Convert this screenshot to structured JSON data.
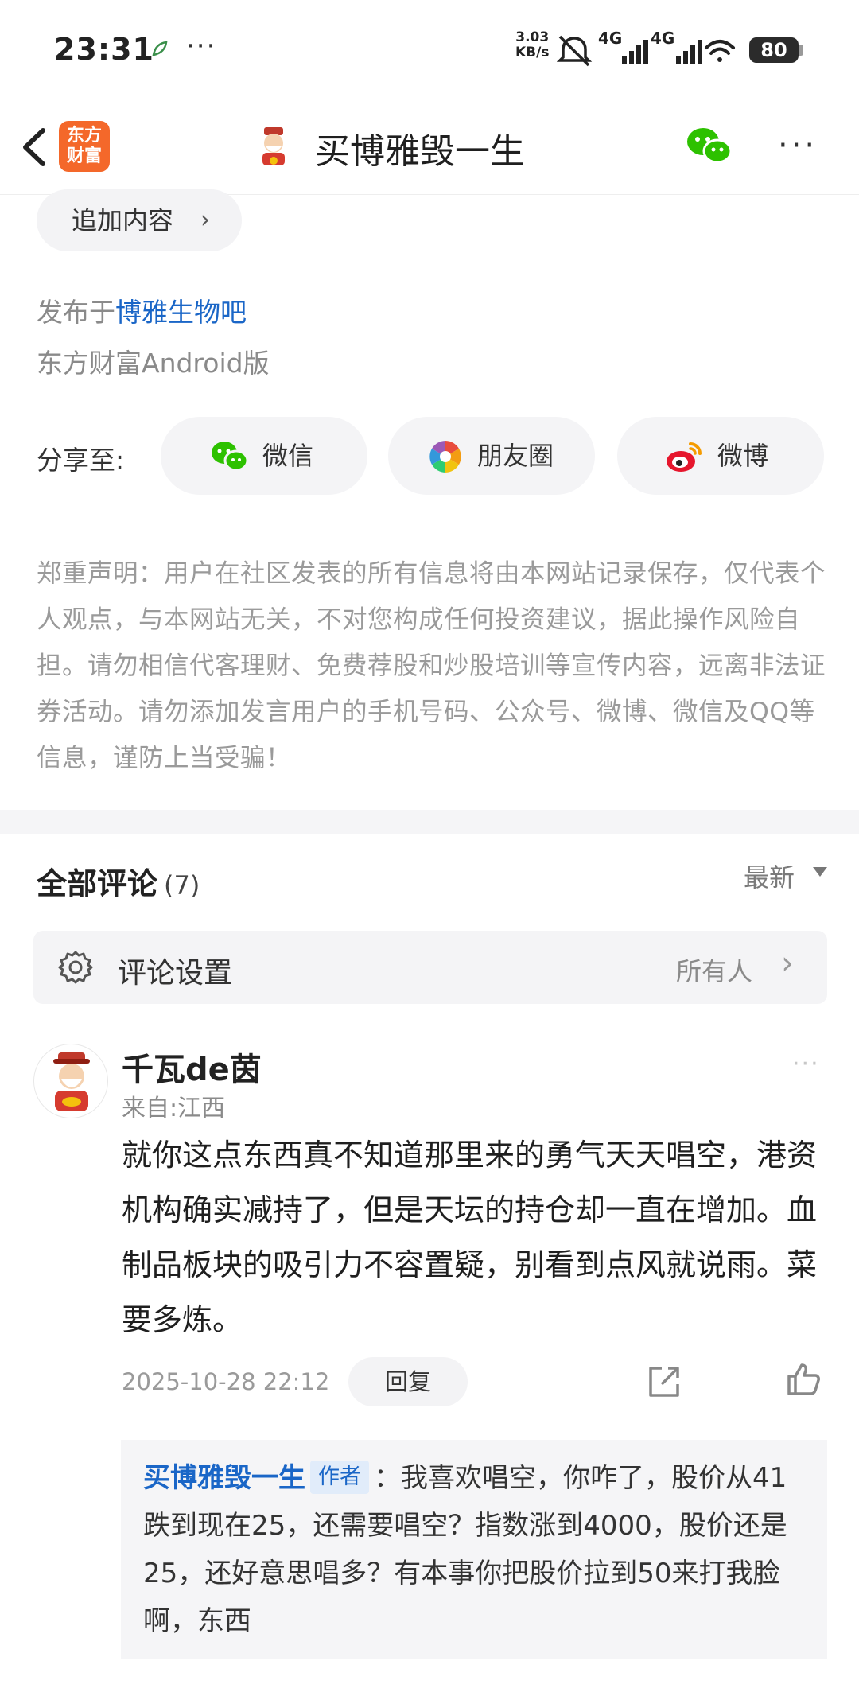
{
  "status_bar": {
    "time": "23:31",
    "speed_value": "3.03",
    "speed_unit": "KB/s",
    "network_1": "4G",
    "network_2": "4G",
    "battery": "80"
  },
  "nav": {
    "logo_line1": "东方",
    "logo_line2": "财富",
    "title": "买博雅毁一生"
  },
  "post": {
    "append_label": "追加内容",
    "publish_prefix": "发布于",
    "forum_link": "博雅生物吧",
    "source": "东方财富Android版"
  },
  "share": {
    "label": "分享至:",
    "wechat": "微信",
    "moments": "朋友圈",
    "weibo": "微博"
  },
  "disclaimer": "郑重声明：用户在社区发表的所有信息将由本网站记录保存，仅代表个人观点，与本网站无关，不对您构成任何投资建议，据此操作风险自担。请勿相信代客理财、免费荐股和炒股培训等宣传内容，远离非法证券活动。请勿添加发言用户的手机号码、公众号、微博、微信及QQ等信息，谨防上当受骗！",
  "comments": {
    "title": "全部评论",
    "count": "(7)",
    "sort": "最新",
    "settings_label": "评论设置",
    "settings_value": "所有人",
    "items": [
      {
        "user": "千瓦de茵",
        "location": "来自:江西",
        "body": "就你这点东西真不知道那里来的勇气天天唱空，港资机构确实减持了，但是天坛的持仓却一直在增加。血制品板块的吸引力不容置疑，别看到点风就说雨。菜要多炼。",
        "date": "2025-10-28 22:12",
        "reply_label": "回复",
        "reply": {
          "author": "买博雅毁一生",
          "tag": "作者",
          "text": "：我喜欢唱空，你咋了，股价从41跌到现在25，还需要唱空？指数涨到4000，股价还是25，还好意思唱多？有本事你把股价拉到50来打我脸啊，东西"
        }
      }
    ]
  },
  "colors": {
    "brand_orange": "#f4682a",
    "link_blue": "#1a66c7",
    "wechat_green": "#2dc100"
  }
}
